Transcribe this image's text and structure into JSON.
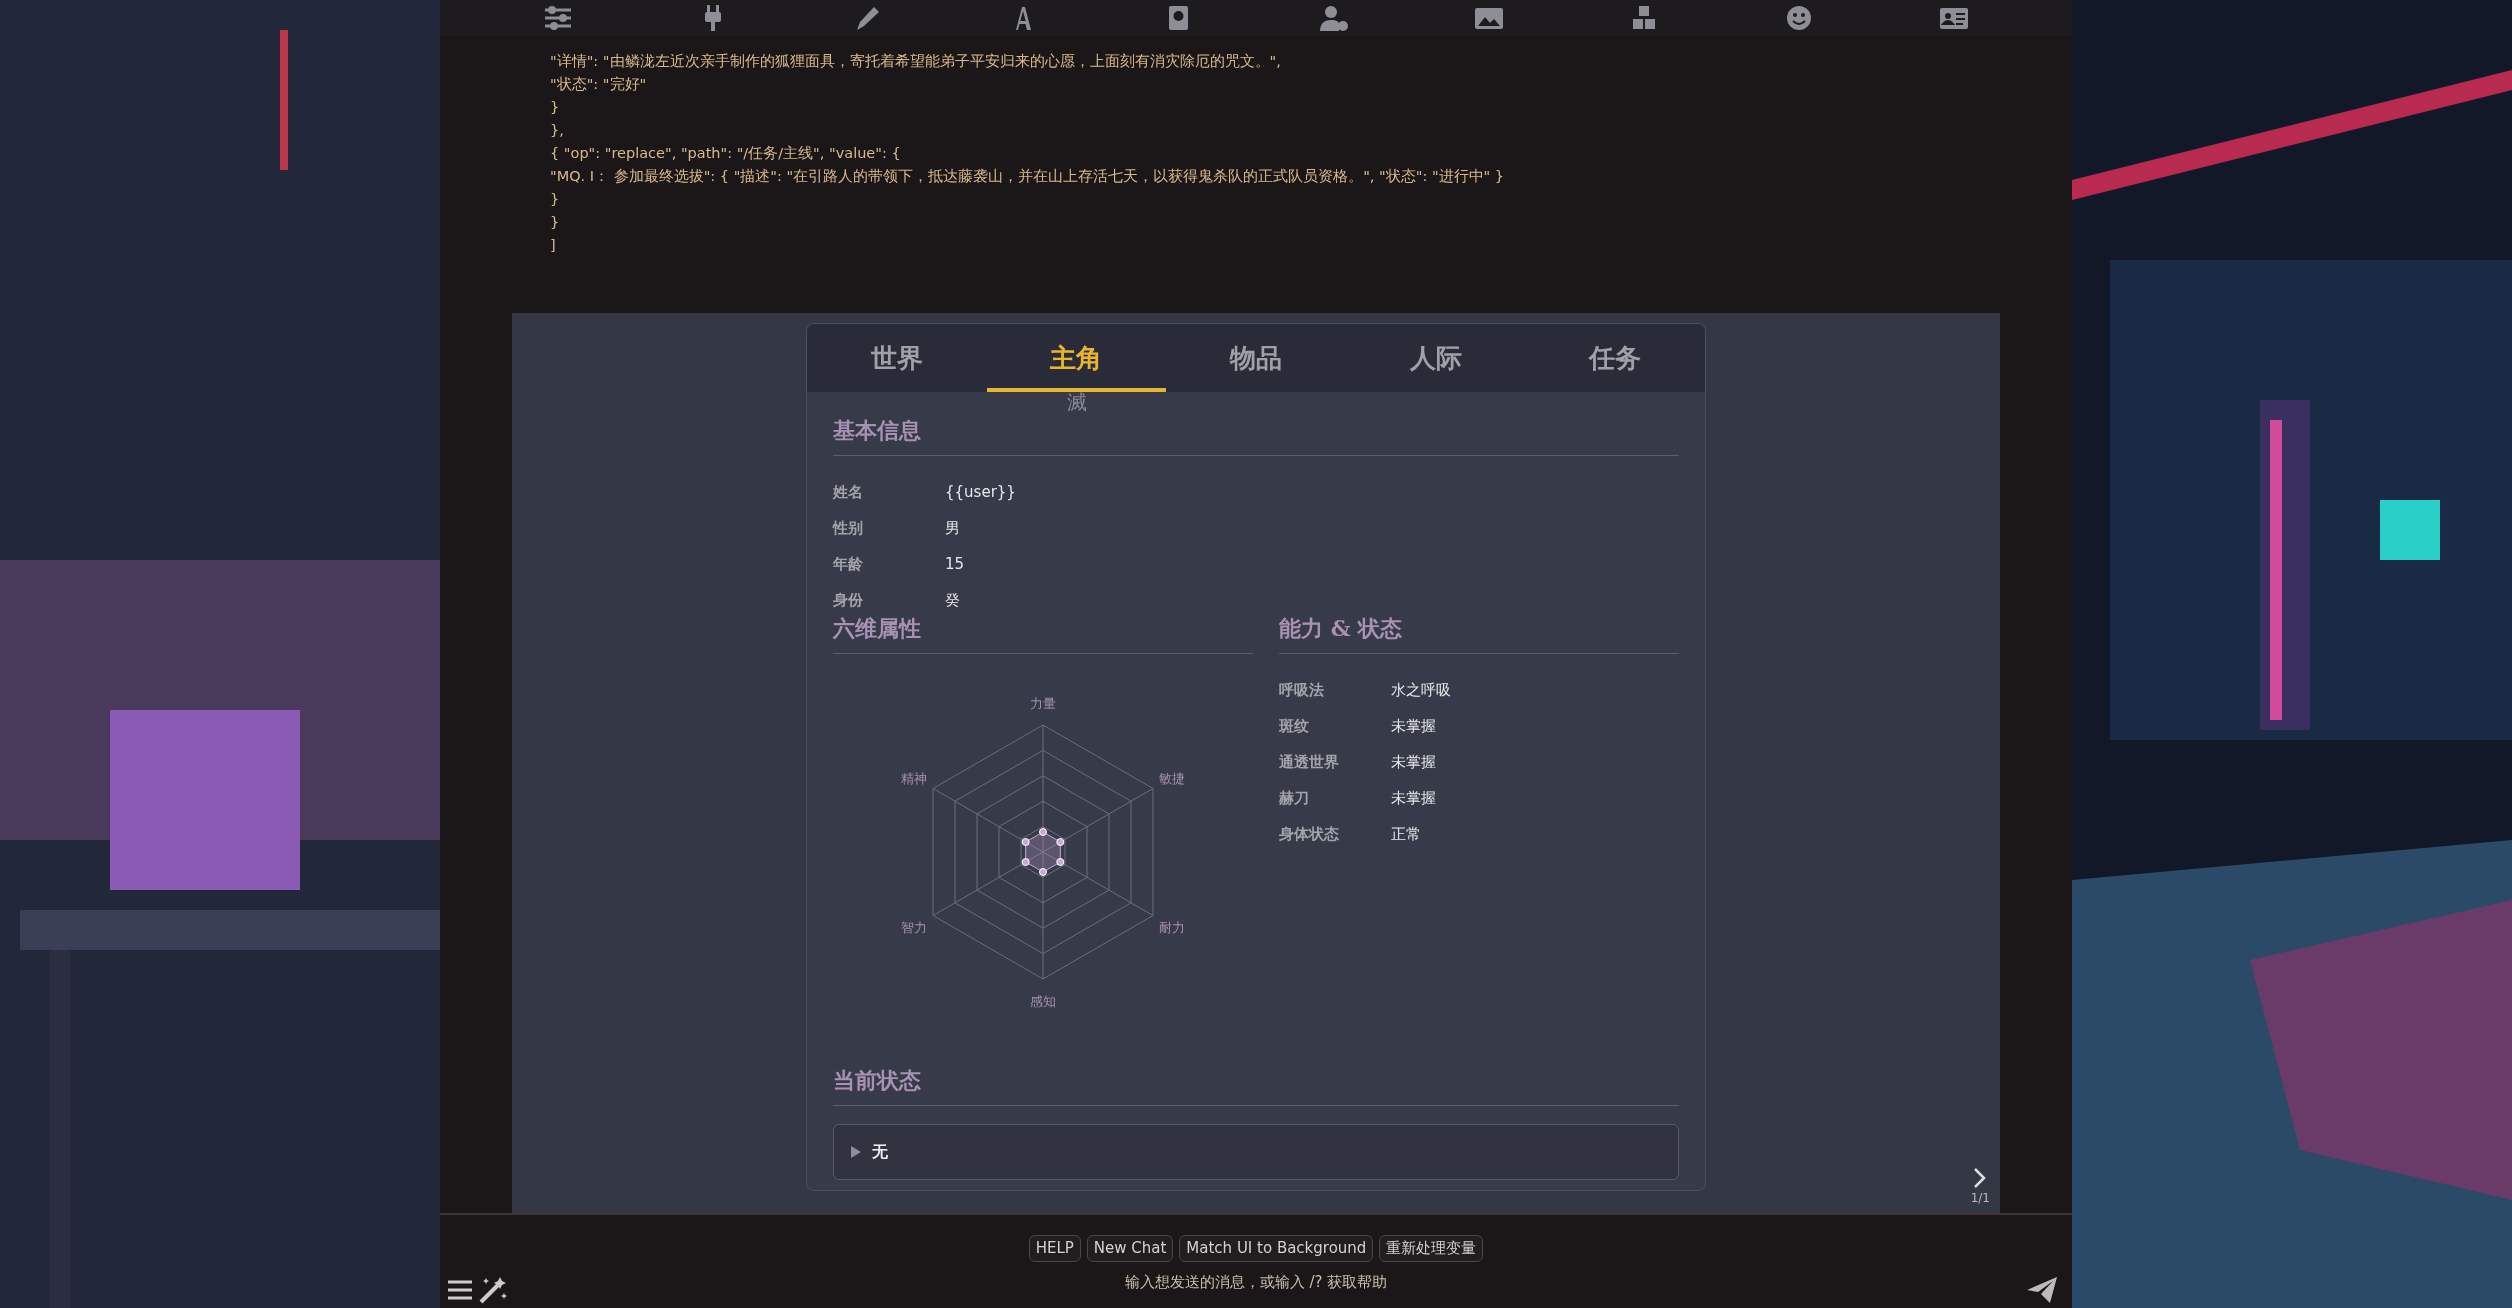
{
  "message": {
    "lines": [
      "\"详情\": \"由鳞泷左近次亲手制作的狐狸面具，寄托着希望能弟子平安归来的心愿，上面刻有消灾除厄的咒文。\",",
      "\"状态\": \"完好\"",
      "}",
      "},",
      "{ \"op\": \"replace\", \"path\": \"/任务/主线\", \"value\": {",
      "\"MQ. I： 参加最终选拔\": { \"描述\": \"在引路人的带领下，抵达藤袭山，并在山上存活七天，以获得鬼杀队的正式队员资格。\", \"状态\": \"进行中\" }",
      "}",
      "}",
      "]"
    ]
  },
  "status_card": {
    "tabs": [
      {
        "label": "世界",
        "selected": false
      },
      {
        "label": "主角",
        "selected": true
      },
      {
        "label": "物品",
        "selected": false
      },
      {
        "label": "**人**际",
        "selected": false
      },
      {
        "label": "**任**务",
        "selected": false
      }
    ],
    "tab_hint": "滅",
    "basic_info": {
      "title": "基本信息",
      "fields": [
        {
          "label": "姓名",
          "value": "{{user}}"
        },
        {
          "label": "性别",
          "value": "男"
        },
        {
          "label": "年龄",
          "value": "15"
        },
        {
          "label": "身份",
          "value": "癸"
        }
      ]
    },
    "attributes": {
      "title": "六维属性",
      "axes": [
        "力量",
        "敏捷",
        "耐力",
        "感知",
        "智力",
        "精神"
      ]
    },
    "abilities": {
      "title": "能力 & 状态",
      "fields": [
        {
          "label": "呼吸法",
          "value": "水之呼吸"
        },
        {
          "label": "斑纹",
          "value": "未掌握"
        },
        {
          "label": "通透世界",
          "value": "未掌握"
        },
        {
          "label": "赫刀",
          "value": "未掌握"
        },
        {
          "label": "身体状态",
          "value": "正常"
        }
      ]
    },
    "current_state": {
      "title": "当前状态",
      "items": [
        {
          "label": "无",
          "expanded": false
        }
      ]
    }
  },
  "swipe": {
    "counter": "1/1"
  },
  "quick_replies": [
    "HELP",
    "New Chat",
    "Match UI to Background",
    "重新处理变量"
  ],
  "input": {
    "placeholder": "输入想发送的消息，或输入 /? 获取帮助"
  }
}
